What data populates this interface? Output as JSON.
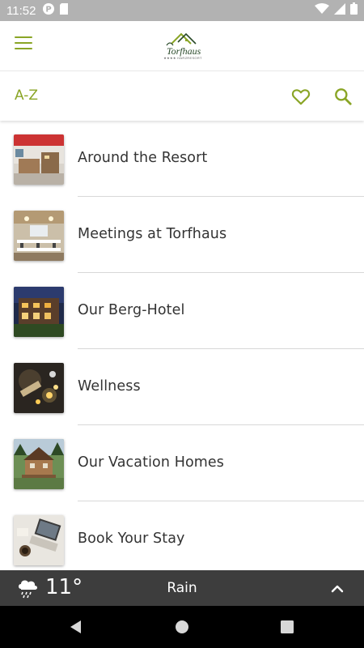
{
  "status_bar": {
    "time": "11:52",
    "left_icons": [
      "at-sign-icon",
      "sd-card-icon"
    ],
    "right_icons": [
      "wifi-icon",
      "signal-icon",
      "battery-icon"
    ]
  },
  "header": {
    "logo_text": "Torfhaus",
    "logo_subtext": "★★★★ HARZRESORT",
    "menu_icon": "hamburger-menu-icon"
  },
  "filter_bar": {
    "az_label": "A-Z",
    "favorites_icon": "heart-icon",
    "search_icon": "search-icon"
  },
  "list": {
    "items": [
      {
        "label": "Around the Resort",
        "thumb": "reception-photo"
      },
      {
        "label": "Meetings at Torfhaus",
        "thumb": "meeting-room-photo"
      },
      {
        "label": "Our Berg-Hotel",
        "thumb": "hotel-night-photo"
      },
      {
        "label": "Wellness",
        "thumb": "wellness-candles-photo"
      },
      {
        "label": "Our Vacation Homes",
        "thumb": "cabin-photo"
      },
      {
        "label": "Book Your Stay",
        "thumb": "laptop-desk-photo"
      }
    ]
  },
  "weather": {
    "icon": "rain-cloud-icon",
    "temperature": "11°",
    "condition": "Rain",
    "expand_icon": "chevron-up-icon"
  },
  "nav_bar": {
    "buttons": [
      "back-icon",
      "home-icon",
      "recents-icon"
    ]
  },
  "colors": {
    "accent": "#8aa526",
    "text": "#333333",
    "weather_bg": "#3d3d3d",
    "status_bg": "#b2b2b2"
  }
}
